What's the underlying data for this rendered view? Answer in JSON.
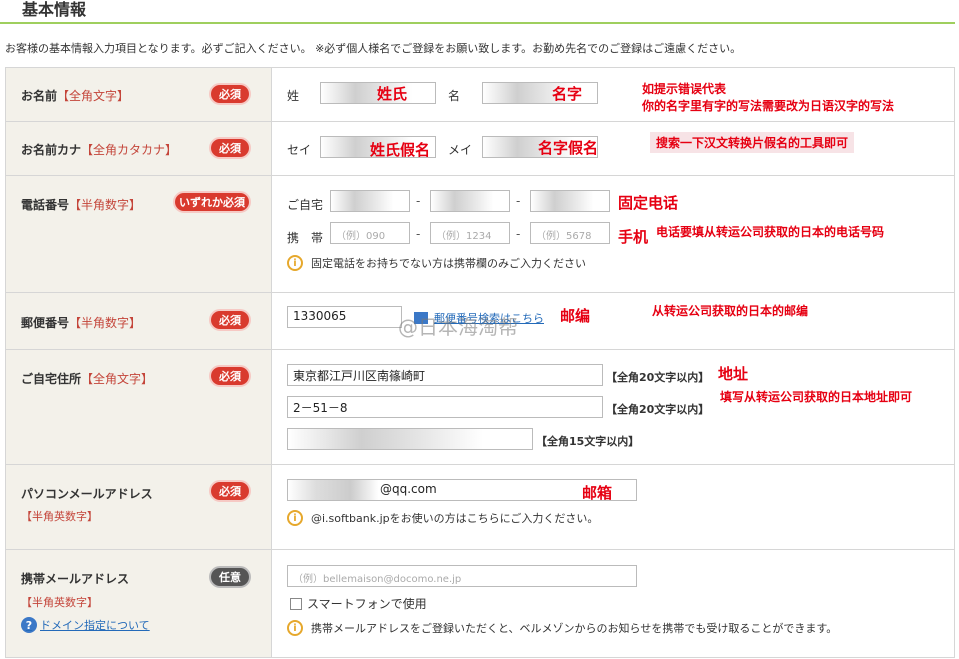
{
  "header": {
    "title": "基本情報",
    "intro": "お客様の基本情報入力項目となります。必ずご記入ください。 ※必ず個人様名でご登録をお願い致します。お勤め先名でのご登録はご遠慮ください。"
  },
  "badges": {
    "required": "必須",
    "either": "いずれか必須",
    "optional": "任意"
  },
  "name_row": {
    "label": "お名前",
    "sub": "【全角文字】",
    "sei_label": "姓",
    "mei_label": "名",
    "sei_value": "",
    "mei_value": "",
    "ann_sei": "姓氏",
    "ann_mei": "名字",
    "ann_note_1": "如提示错误代表",
    "ann_note_2": "你的名字里有字的写法需要改为日语汉字的写法"
  },
  "kana_row": {
    "label": "お名前カナ",
    "sub": "【全角カタカナ】",
    "sei_label": "セイ",
    "mei_label": "メイ",
    "sei_value": "",
    "mei_value": "",
    "ann_sei": "姓氏假名",
    "ann_mei": "名字假名",
    "ann_note": "搜索一下汉文转换片假名的工具即可"
  },
  "phone_row": {
    "label": "電話番号",
    "sub": "【半角数字】",
    "home_label": "ご自宅",
    "mobile_label": "携　帯",
    "dash": "-",
    "mobile_ph_1": "（例）090",
    "mobile_ph_2": "（例）1234",
    "mobile_ph_3": "（例）5678",
    "note": "固定電話をお持ちでない方は携帯欄のみご入力ください",
    "ann_home": "固定电话",
    "ann_mobile": "手机",
    "ann_note": "电话要填从转运公司获取的日本的电话号码"
  },
  "zip_row": {
    "label": "郵便番号",
    "sub": "【半角数字】",
    "value": "1330065",
    "lookup": "郵便番号検索はこちら",
    "watermark": "@日本海淘帮",
    "ann": "邮编",
    "ann_note": "从转运公司获取的日本的邮编"
  },
  "address_row": {
    "label": "ご自宅住所",
    "sub": "【全角文字】",
    "line1": "東京都江戸川区南篠崎町",
    "line2": "2－51－8",
    "line3": "",
    "limit20": "【全角20文字以内】",
    "limit15": "【全角15文字以内】",
    "ann": "地址",
    "ann_note": "填写从转运公司获取的日本地址即可"
  },
  "pc_mail_row": {
    "label": "パソコンメールアドレス",
    "sub": "【半角英数字】",
    "value": "@qq.com",
    "note": "@i.softbank.jpをお使いの方はこちらにご入力ください。",
    "ann": "邮箱"
  },
  "mobile_mail_row": {
    "label": "携帯メールアドレス",
    "sub": "【半角英数字】",
    "placeholder": "（例）bellemaison@docomo.ne.jp",
    "smartphone": "スマートフォンで使用",
    "help": "ドメイン指定について",
    "note": "携帯メールアドレスをご登録いただくと、ベルメゾンからのお知らせを携帯でも受け取ることができます。"
  },
  "colors": {
    "accent_green": "#9fcf5e",
    "badge_red": "#d93a2e",
    "annotation_red": "#e60012",
    "label_bg": "#f3f1ea"
  },
  "icons": {
    "info": "info-icon",
    "help": "question-icon",
    "zip": "zip-lookup-icon"
  }
}
